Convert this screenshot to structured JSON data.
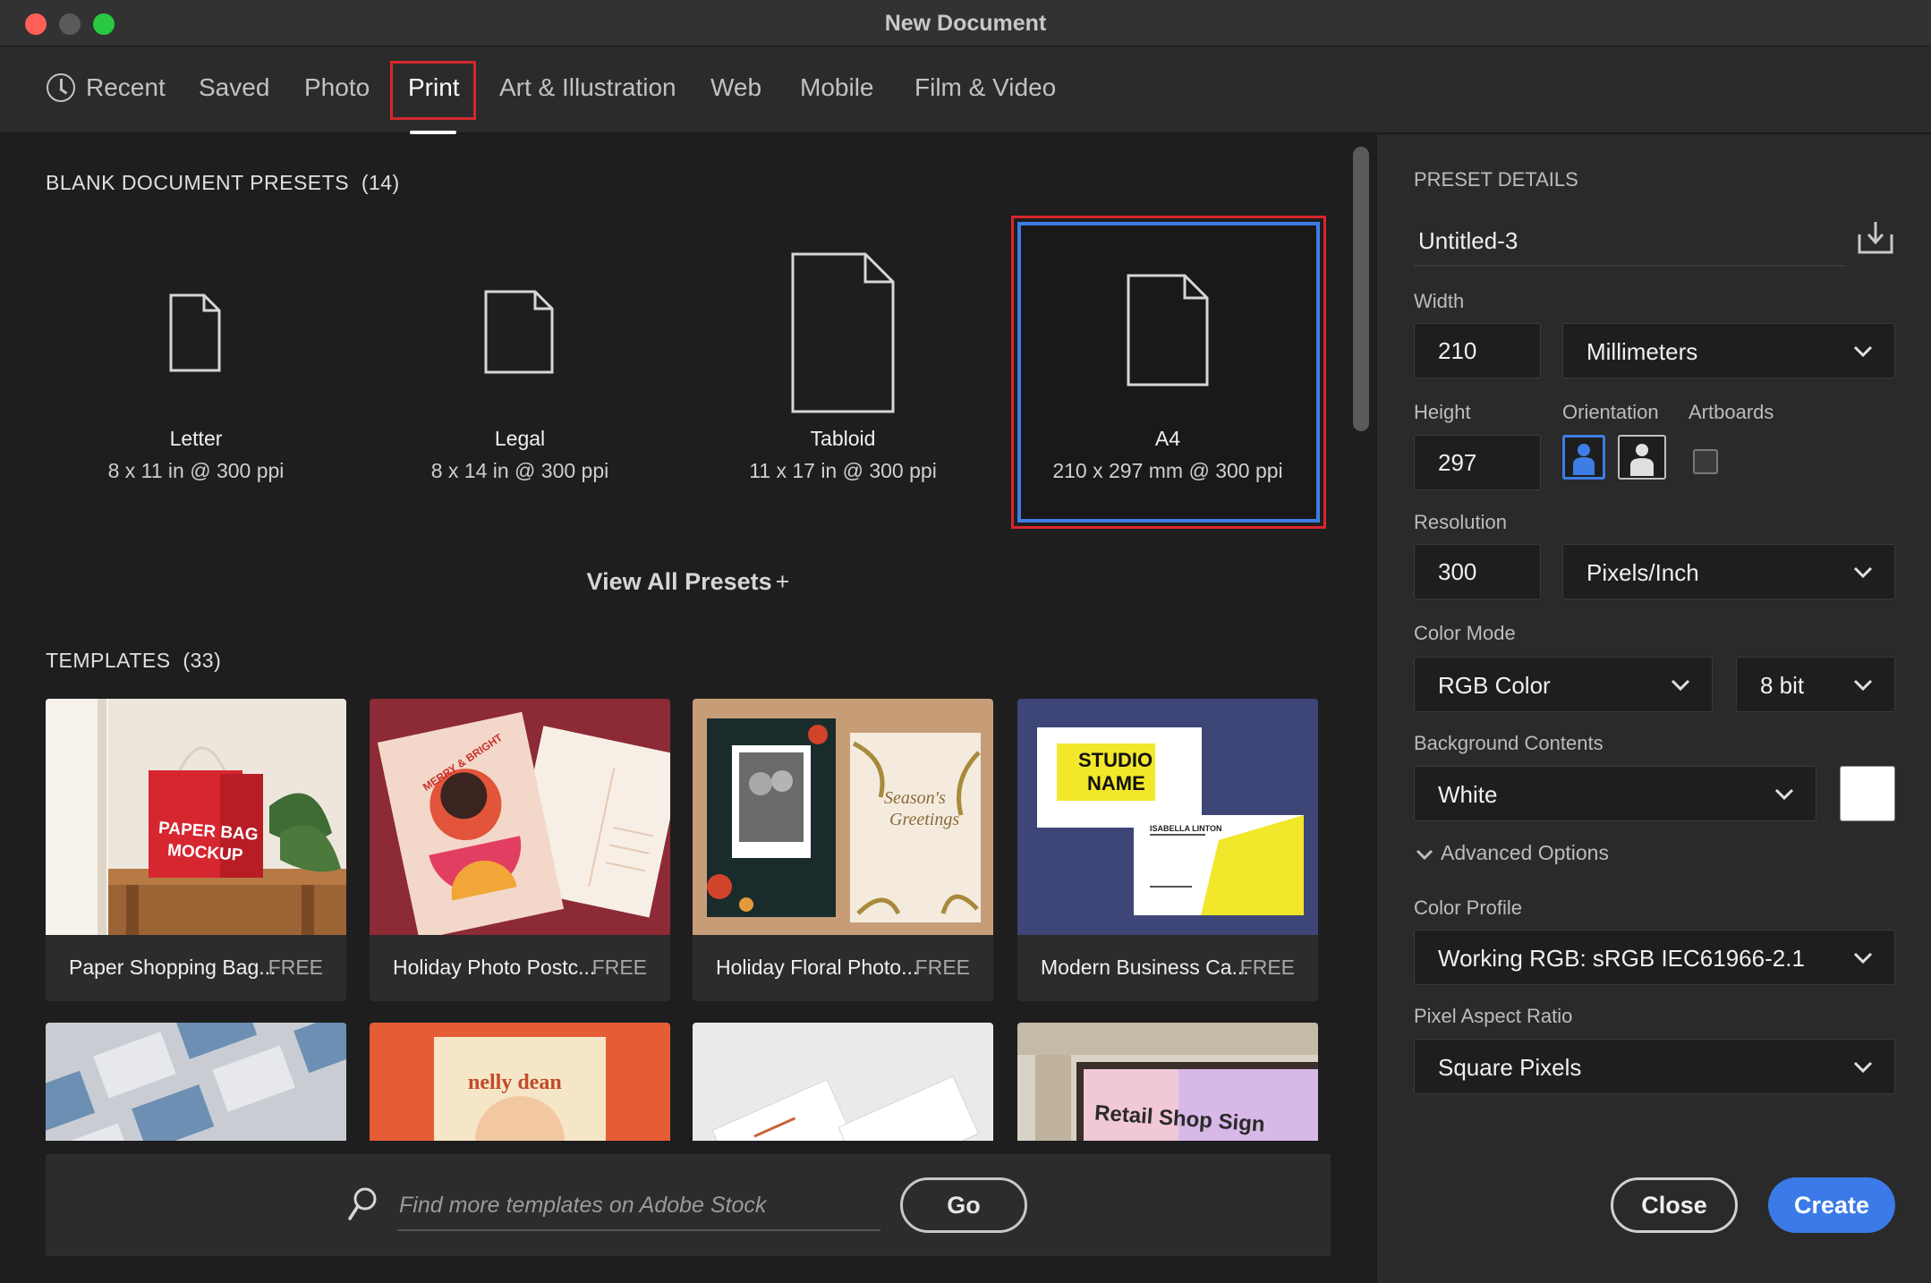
{
  "window": {
    "title": "New Document"
  },
  "tabs": [
    {
      "label": "Recent"
    },
    {
      "label": "Saved"
    },
    {
      "label": "Photo"
    },
    {
      "label": "Print"
    },
    {
      "label": "Art & Illustration"
    },
    {
      "label": "Web"
    },
    {
      "label": "Mobile"
    },
    {
      "label": "Film & Video"
    }
  ],
  "active_tab": "Print",
  "presets_section": {
    "title": "BLANK DOCUMENT PRESETS",
    "count": "(14)"
  },
  "presets": [
    {
      "name": "Letter",
      "size": "8 x 11 in @ 300 ppi"
    },
    {
      "name": "Legal",
      "size": "8 x 14 in @ 300 ppi"
    },
    {
      "name": "Tabloid",
      "size": "11 x 17 in @ 300 ppi"
    },
    {
      "name": "A4",
      "size": "210 x 297 mm @ 300 ppi"
    }
  ],
  "selected_preset": "A4",
  "view_all": {
    "label": "View All Presets",
    "icon": "+"
  },
  "templates_section": {
    "title": "TEMPLATES",
    "count": "(33)"
  },
  "templates": [
    {
      "name": "Paper Shopping Bag...",
      "badge": "FREE",
      "thumb_text": [
        "PAPER BAG",
        "MOCKUP"
      ]
    },
    {
      "name": "Holiday Photo Postc...",
      "badge": "FREE",
      "thumb_text": [
        "MERRY & BRIGHT"
      ]
    },
    {
      "name": "Holiday Floral Photo...",
      "badge": "FREE",
      "thumb_text": [
        "Season's",
        "Greetings"
      ]
    },
    {
      "name": "Modern Business Ca...",
      "badge": "FREE",
      "thumb_text": [
        "STUDIO",
        "NAME",
        "ISABELLA LINTON"
      ]
    }
  ],
  "templates_row2": [
    {
      "thumb_text": ""
    },
    {
      "thumb_text": "nelly dean"
    },
    {
      "thumb_text": ""
    },
    {
      "thumb_text": "Retail Shop Sign"
    }
  ],
  "stock": {
    "placeholder": "Find more templates on Adobe Stock",
    "go_label": "Go"
  },
  "preset_details": {
    "title": "PRESET DETAILS",
    "doc_name": "Untitled-3",
    "width_label": "Width",
    "width_value": "210",
    "width_unit": "Millimeters",
    "height_label": "Height",
    "height_value": "297",
    "orientation_label": "Orientation",
    "artboards_label": "Artboards",
    "resolution_label": "Resolution",
    "resolution_value": "300",
    "resolution_unit": "Pixels/Inch",
    "color_mode_label": "Color Mode",
    "color_mode": "RGB Color",
    "bit_depth": "8 bit",
    "background_label": "Background Contents",
    "background": "White",
    "background_color": "#ffffff",
    "advanced_label": "Advanced Options",
    "color_profile_label": "Color Profile",
    "color_profile": "Working RGB: sRGB IEC61966-2.1",
    "pixel_aspect_label": "Pixel Aspect Ratio",
    "pixel_aspect": "Square Pixels"
  },
  "actions": {
    "close_label": "Close",
    "create_label": "Create"
  },
  "colors": {
    "accent": "#3b7ae8",
    "highlight": "#d8262d",
    "background": "#1e1e1e",
    "panel": "#2a2a2a"
  }
}
